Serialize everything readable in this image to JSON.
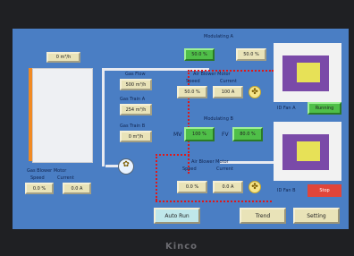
{
  "device": {
    "brand": "Kinco"
  },
  "top_value": "0 m³/h",
  "left": {
    "title": "Gas Blower Motor",
    "speed_label": "Speed",
    "current_label": "Current",
    "speed_value": "0.0 %",
    "current_value": "0.0 A"
  },
  "gas": {
    "flow_label": "Gas Flow",
    "flow_value": "500 m³/h",
    "train_a_label": "Gas Train A",
    "train_a_value": "254 m³/h",
    "train_b_label": "Gas Train B",
    "train_b_value": "0 m³/h"
  },
  "mod_a": {
    "title": "Modulating A",
    "mv_value": "50.0 %",
    "fv_value": "50.0 %"
  },
  "air_a": {
    "title": "Air Blower Motor",
    "speed_label": "Speed",
    "current_label": "Current",
    "speed_value": "50.0 %",
    "current_value": "100 A"
  },
  "mod_b": {
    "title": "Modulating B",
    "mv_label": "MV",
    "fv_label": "FV",
    "mv_value": "100 %",
    "fv_value": "80.0 %"
  },
  "air_b": {
    "title": "Air Blower Motor",
    "speed_label": "Speed",
    "current_label": "Current",
    "speed_value": "0.0 %",
    "current_value": "0.0 A"
  },
  "right": {
    "run_a_label": "ID Fan A",
    "run_a_button": "Running",
    "run_b_label": "ID Fan B",
    "run_b_button": "Stop"
  },
  "nav": {
    "auto_run": "Auto Run",
    "trend": "Trend",
    "setting": "Setting"
  },
  "colors": {
    "screen_bg": "#4a7ec4",
    "value_box": "#e9e3b8",
    "active_box": "#4fbf48",
    "stop_red": "#e0453a",
    "flow_line": "#e01818"
  }
}
